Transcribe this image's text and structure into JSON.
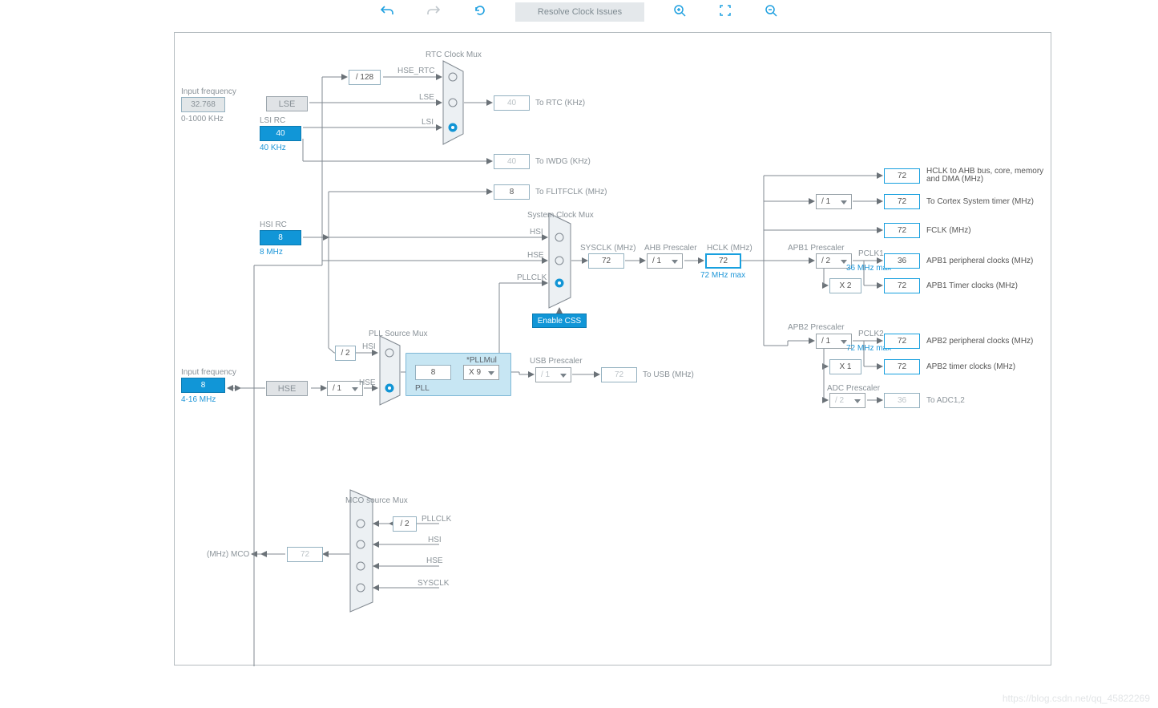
{
  "toolbar": {
    "resolve": "Resolve Clock Issues"
  },
  "icons": {
    "undo": "↶",
    "redo": "↷",
    "refresh": "⟳",
    "zoomin": "🔍+",
    "fit": "⛶",
    "zoomout": "🔍−"
  },
  "watermark": "https://blog.csdn.net/qq_45822269",
  "lse": {
    "title": "Input frequency",
    "val": "32.768",
    "range": "0-1000 KHz",
    "label": "LSE",
    "lsi_rc": "LSI RC",
    "lsi_val": "40",
    "lsi_note": "40 KHz"
  },
  "hse": {
    "title": "Input frequency",
    "val": "8",
    "range": "4-16 MHz",
    "label": "HSE",
    "presc": "/ 1"
  },
  "hsi": {
    "title": "HSI RC",
    "val": "8",
    "note": "8 MHz"
  },
  "rtc": {
    "title": "RTC Clock Mux",
    "div": "/ 128",
    "hse_rtc": "HSE_RTC",
    "lse": "LSE",
    "lsi": "LSI",
    "out": "40",
    "out_label": "To RTC (KHz)"
  },
  "iwdg": {
    "val": "40",
    "label": "To IWDG (KHz)"
  },
  "flit": {
    "val": "8",
    "label": "To FLITFCLK (MHz)"
  },
  "pll": {
    "title": "PLL Source Mux",
    "div2": "/ 2",
    "hsi": "HSI",
    "hse": "HSE",
    "plllabel": "PLL",
    "pllmul_lbl": "*PLLMul",
    "pllin": "8",
    "pllmul": "X 9"
  },
  "usb": {
    "title": "USB Prescaler",
    "sel": "/ 1",
    "val": "72",
    "label": "To USB (MHz)"
  },
  "sys": {
    "title": "System Clock Mux",
    "hsi": "HSI",
    "hse": "HSE",
    "pllclk": "PLLCLK",
    "sysclk_lbl": "SYSCLK (MHz)",
    "sysclk": "72"
  },
  "css": {
    "label": "Enable CSS"
  },
  "ahb": {
    "title": "AHB Prescaler",
    "sel": "/ 1",
    "hclk_lbl": "HCLK (MHz)",
    "hclk": "72",
    "hclk_note": "72 MHz max"
  },
  "apb1": {
    "title": "APB1 Prescaler",
    "sel": "/ 2",
    "pclk1_lbl": "PCLK1",
    "pclk1_note": "36 MHz max",
    "mult": "X 2"
  },
  "apb2": {
    "title": "APB2 Prescaler",
    "sel": "/ 1",
    "pclk2_lbl": "PCLK2",
    "pclk2_note": "72 MHz max",
    "mult": "X 1"
  },
  "adc": {
    "title": "ADC Prescaler",
    "sel": "/ 2"
  },
  "out": {
    "hclk_ahb": {
      "v": "72",
      "l": "HCLK to AHB bus, core, memory and DMA (MHz)"
    },
    "cortex": {
      "sel": "/ 1",
      "v": "72",
      "l": "To Cortex System timer (MHz)"
    },
    "fclk": {
      "v": "72",
      "l": "FCLK (MHz)"
    },
    "apb1p": {
      "v": "36",
      "l": "APB1 peripheral clocks (MHz)"
    },
    "apb1t": {
      "v": "72",
      "l": "APB1 Timer clocks (MHz)"
    },
    "apb2p": {
      "v": "72",
      "l": "APB2 peripheral clocks (MHz)"
    },
    "apb2t": {
      "v": "72",
      "l": "APB2 timer clocks (MHz)"
    },
    "adc": {
      "v": "36",
      "l": "To ADC1,2"
    }
  },
  "mco": {
    "title": "MCO source Mux",
    "div": "/ 2",
    "pllclk": "PLLCLK",
    "hsi": "HSI",
    "hse": "HSE",
    "sysclk": "SYSCLK",
    "out": "72",
    "out_label": "(MHz) MCO"
  }
}
